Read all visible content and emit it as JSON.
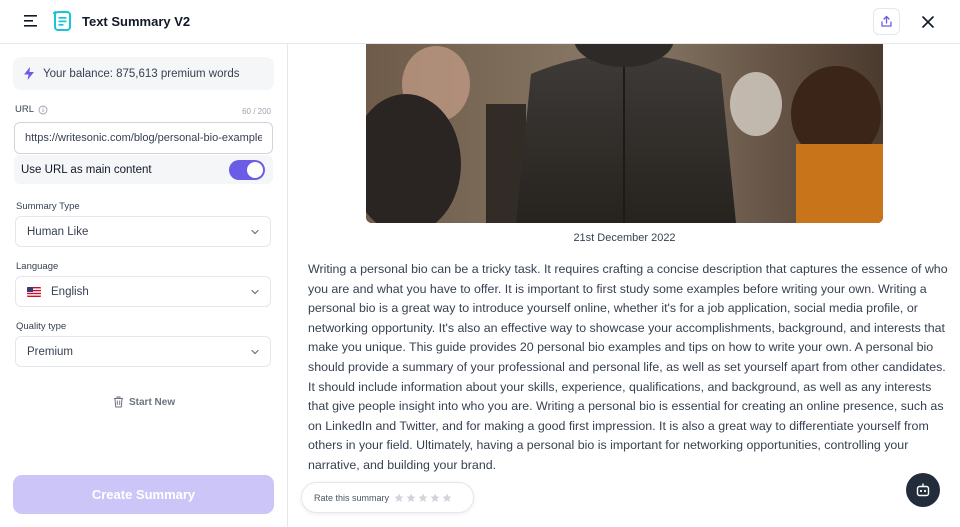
{
  "app": {
    "title": "Text Summary V2"
  },
  "balance": {
    "text": "Your balance: 875,613 premium words"
  },
  "url": {
    "label": "URL",
    "counter": "60 / 200",
    "value": "https://writesonic.com/blog/personal-bio-examples",
    "use_as_main_label": "Use URL as main content",
    "use_as_main_enabled": true
  },
  "summary_type": {
    "label": "Summary Type",
    "value": "Human Like"
  },
  "language": {
    "label": "Language",
    "value": "English"
  },
  "quality": {
    "label": "Quality type",
    "value": "Premium"
  },
  "start_new": "Start New",
  "create_button": "Create Summary",
  "article": {
    "date": "21st December 2022",
    "body": "Writing a personal bio can be a tricky task. It requires crafting a concise description that captures the essence of who you are and what you have to offer. It is important to first study some examples before writing your own. Writing a personal bio is a great way to introduce yourself online, whether it's for a job application, social media profile, or networking opportunity. It's also an effective way to showcase your accomplishments, background, and interests that make you unique. This guide provides 20 personal bio examples and tips on how to write your own. A personal bio should provide a summary of your professional and personal life, as well as set yourself apart from other candidates. It should include information about your skills, experience, qualifications, and background, as well as any interests that give people insight into who you are. Writing a personal bio is essential for creating an online presence, such as on LinkedIn and Twitter, and for making a good first impression. It is also a great way to differentiate yourself from others in your field. Ultimately, having a personal bio is important for networking opportunities, controlling your narrative, and building your brand."
  },
  "rating": {
    "label": "Rate this summary",
    "max_stars": 5,
    "value": 0
  },
  "colors": {
    "accent": "#6b5ce7",
    "accent_light": "#cbc6f7",
    "dark": "#232c3a"
  },
  "icons": [
    "menu-icon",
    "app-logo-icon",
    "share-icon",
    "close-icon",
    "bolt-icon",
    "info-icon",
    "chevron-down-icon",
    "us-flag-icon",
    "trash-icon",
    "star-icon",
    "bot-icon"
  ]
}
